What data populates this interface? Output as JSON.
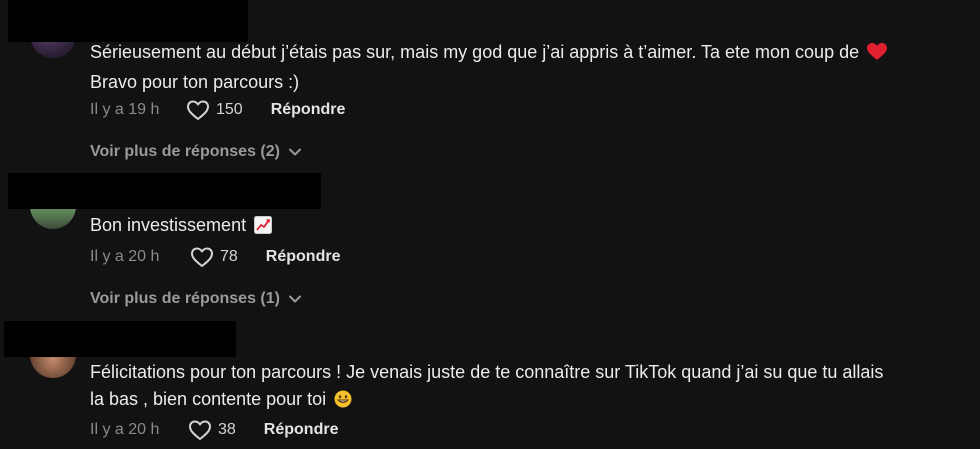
{
  "comments": [
    {
      "text_line1": "Sérieusement au début j’étais pas sur, mais my god que j’ai appris à t’aimer. Ta ete mon coup de",
      "text_line2": "Bravo pour ton parcours :)",
      "emoji": "red-heart-emoji",
      "time": "Il y a 19 h",
      "likes": "150",
      "reply_label": "Répondre",
      "more_replies": "Voir plus de réponses (2)"
    },
    {
      "text_line1": "Bon investissement",
      "emoji": "chart-increasing-emoji",
      "time": "Il y a 20 h",
      "likes": "78",
      "reply_label": "Répondre",
      "more_replies": "Voir plus de réponses (1)"
    },
    {
      "text_line1": "Félicitations pour ton parcours ! Je venais juste de te connaître sur TikTok quand j’ai su que tu allais",
      "text_line2": "la bas , bien contente pour toi",
      "emoji": "grinning-face-emoji",
      "time": "Il y a 20 h",
      "likes": "38",
      "reply_label": "Répondre"
    }
  ],
  "colors": {
    "background": "#121212",
    "text": "#ececec",
    "muted": "#8a8a8e",
    "heart_emoji": "#e0202e"
  }
}
